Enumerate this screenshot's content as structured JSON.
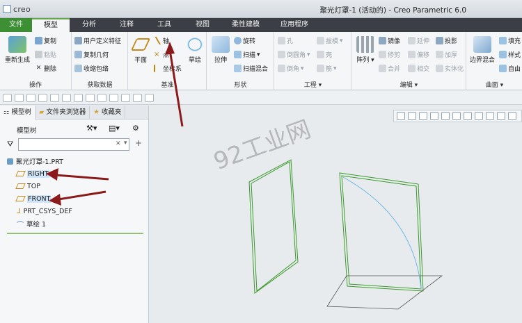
{
  "titlebar": {
    "logo_text": "creo",
    "window_title": "聚光灯罩-1 (活动的) - Creo Parametric 6.0"
  },
  "tabs": [
    "文件",
    "模型",
    "分析",
    "注释",
    "工具",
    "视图",
    "柔性建模",
    "应用程序"
  ],
  "ribbon": {
    "operations": {
      "regen": "重新生成",
      "copy": "复制",
      "paste": "粘贴",
      "delete": "删除",
      "label": "操作"
    },
    "get_data": {
      "udf": "用户定义特征",
      "copy_geom": "复制几何",
      "shrinkwrap": "收缩包络",
      "label": "获取数据"
    },
    "datum": {
      "plane": "平面",
      "axis": "轴",
      "point": "点",
      "csys": "坐标系",
      "sketch": "草绘",
      "label": "基准"
    },
    "shapes": {
      "extrude": "拉伸",
      "revolve": "旋转",
      "sweep": "扫描",
      "swept_blend": "扫描混合",
      "label": "形状"
    },
    "engineering": {
      "hole": "孔",
      "round": "倒圆角",
      "chamfer": "倒角",
      "draft": "拔模",
      "shell": "壳",
      "rib": "筋",
      "label": "工程"
    },
    "editing": {
      "pattern": "阵列",
      "mirror": "镜像",
      "trim": "修剪",
      "merge": "合并",
      "extend": "延伸",
      "offset": "偏移",
      "intersect": "相交",
      "project": "投影",
      "thicken": "加厚",
      "solidify": "实体化",
      "label": "编辑"
    },
    "surfaces": {
      "boundary": "边界混合",
      "fill": "填充",
      "style": "样式",
      "freestyle": "自由",
      "label": "曲面"
    }
  },
  "panel": {
    "tabs": [
      "模型树",
      "文件夹浏览器",
      "收藏夹"
    ],
    "tree_label": "模型树",
    "filter_placeholder": "",
    "items": [
      "聚光灯罩-1.PRT",
      "RIGHT",
      "TOP",
      "FRONT",
      "PRT_CSYS_DEF",
      "草绘 1"
    ]
  },
  "viewport": {
    "watermark": "92工业网"
  },
  "colors": {
    "file_tab": "#3d8f34",
    "tab_bar": "#3b3f45",
    "green_geometry": "#3a9a2a",
    "curve": "#6ab7e0",
    "arrow": "#8b1a1a"
  }
}
